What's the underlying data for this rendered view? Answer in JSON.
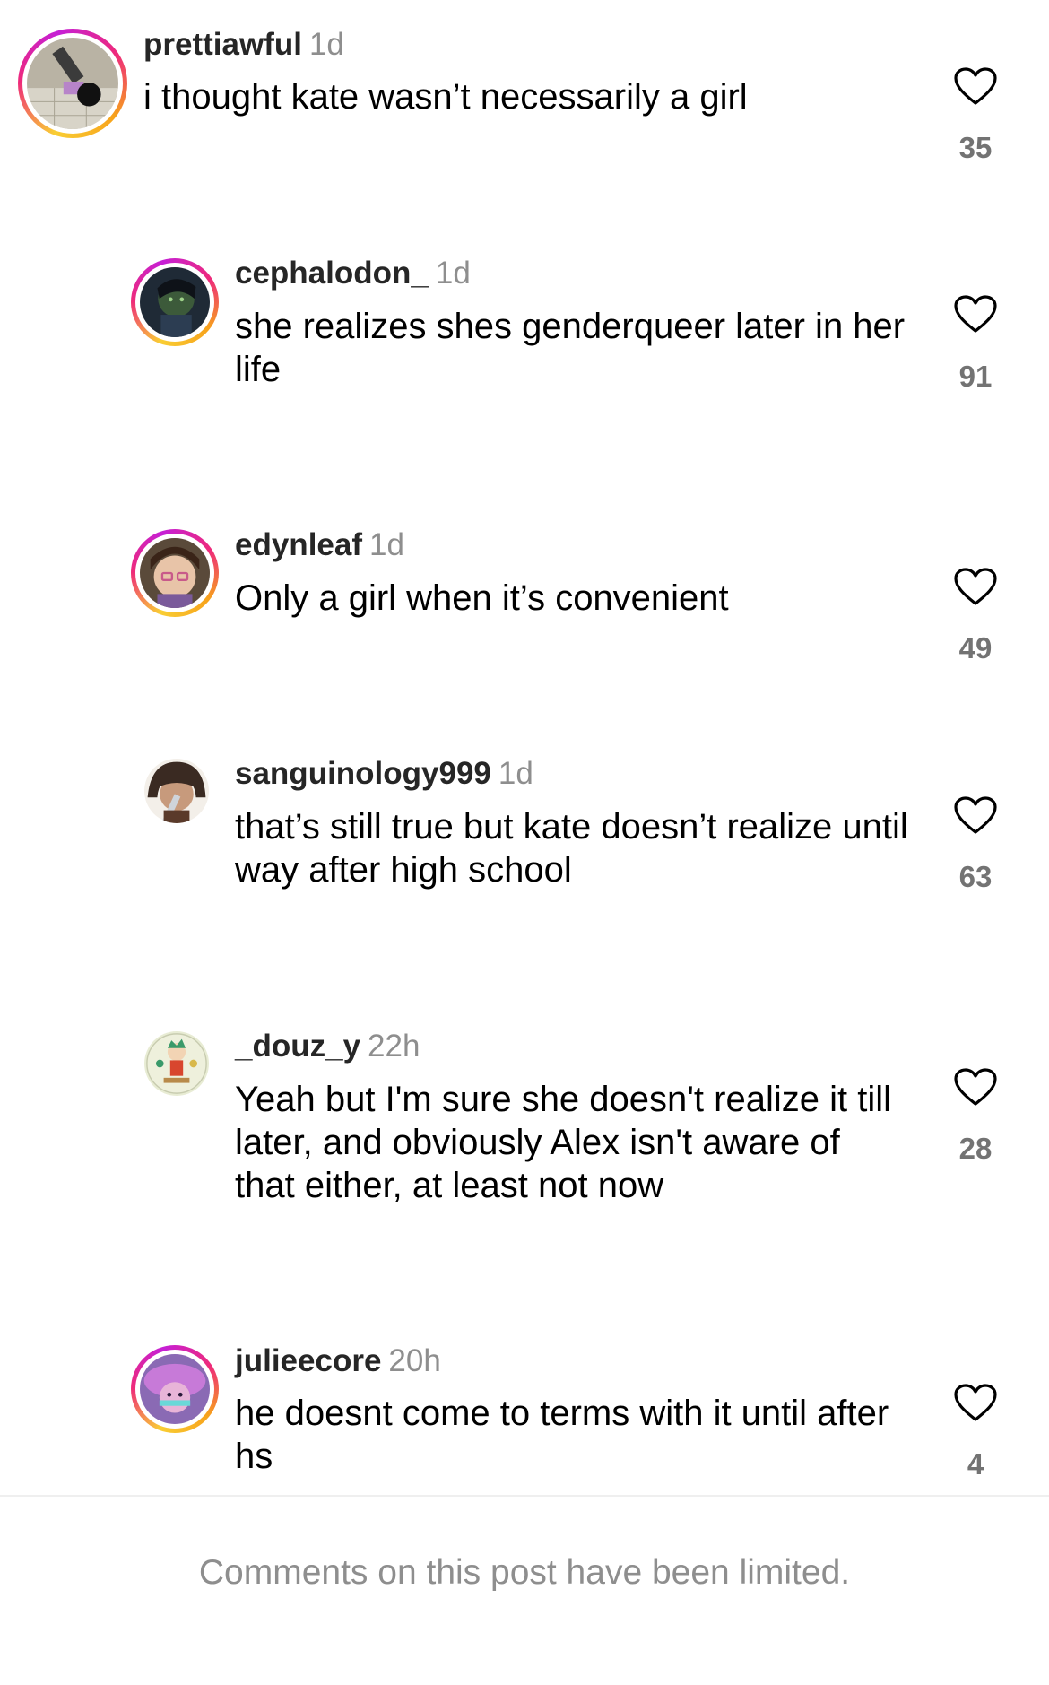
{
  "comments": [
    {
      "username": "prettiawful",
      "time": "1d",
      "text": "i thought kate wasn’t necessarily a girl",
      "likes": "35"
    },
    {
      "username": "cephalodon_",
      "time": "1d",
      "text": "she realizes shes genderqueer later in her life",
      "likes": "91"
    },
    {
      "username": "edynleaf",
      "time": "1d",
      "text": "Only a girl when it’s convenient",
      "likes": "49"
    },
    {
      "username": "sanguinology999",
      "time": "1d",
      "text": "that’s still true but kate doesn’t realize until way after high school",
      "likes": "63"
    },
    {
      "username": "_douz_y",
      "time": "22h",
      "text": "Yeah but I'm sure she doesn't realize it till later, and obviously Alex isn't aware of that either, at least not now",
      "likes": "28"
    },
    {
      "username": "julieecore",
      "time": "20h",
      "text": "he doesnt come to terms with it until after hs",
      "likes": "4"
    }
  ],
  "footer": {
    "limited_notice": "Comments on this post have been limited."
  },
  "icons": {
    "like": "heart-outline-icon"
  },
  "colors": {
    "username": "#262626",
    "timestamp": "#8e8e8e",
    "like_count": "#737373",
    "story_ring_start": "#f9ce34",
    "story_ring_mid": "#ee2a7b",
    "story_ring_end": "#c51fd6"
  }
}
